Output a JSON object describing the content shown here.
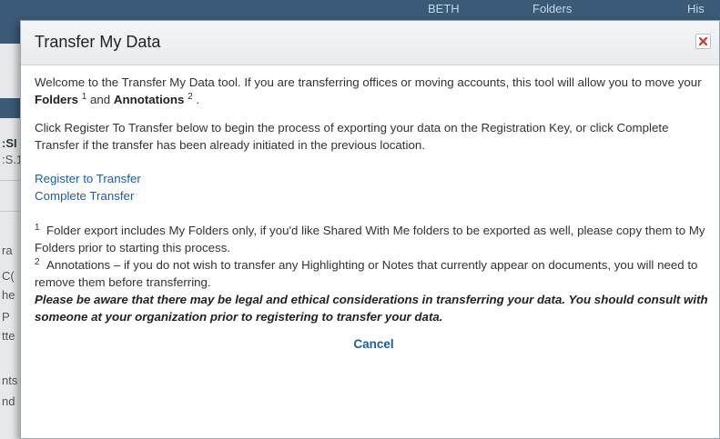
{
  "background": {
    "top_nav": [
      "BETH",
      "Folders",
      "His"
    ],
    "left_fragments": [
      ":SI",
      ":S.1",
      "ra",
      "C(",
      "he",
      "P",
      "tte",
      "nts",
      "nd"
    ]
  },
  "modal": {
    "title": "Transfer My Data",
    "intro": {
      "text_before": "Welcome to the Transfer My Data tool. If you are transferring offices or moving accounts, this tool will allow you to move your ",
      "folders_label": "Folders",
      "folders_sup": "1",
      "and_text": " and ",
      "annotations_label": "Annotations",
      "annotations_sup": "2",
      "end": "."
    },
    "instructions": "Click Register To Transfer below to begin the process of exporting your data on the Registration Key, or click Complete Transfer if the transfer has been already initiated in the previous location.",
    "links": {
      "register": "Register to Transfer",
      "complete": "Complete Transfer"
    },
    "notes": [
      {
        "sup": "1",
        "text": "Folder export includes My Folders only, if you'd like Shared With Me folders to be exported as well, please copy them to My Folders prior to starting this process."
      },
      {
        "sup": "2",
        "text": "Annotations – if you do not wish to transfer any Highlighting or Notes that currently appear on documents, you will need to remove them before transferring."
      }
    ],
    "warning": "Please be aware that there may be legal and ethical considerations in transferring your data. You should consult with someone at your organization prior to registering to transfer your data.",
    "cancel_label": "Cancel"
  },
  "colors": {
    "link": "#1a5fa8",
    "close_x": "#c0392b",
    "nav_bar": "#3a5a78"
  }
}
